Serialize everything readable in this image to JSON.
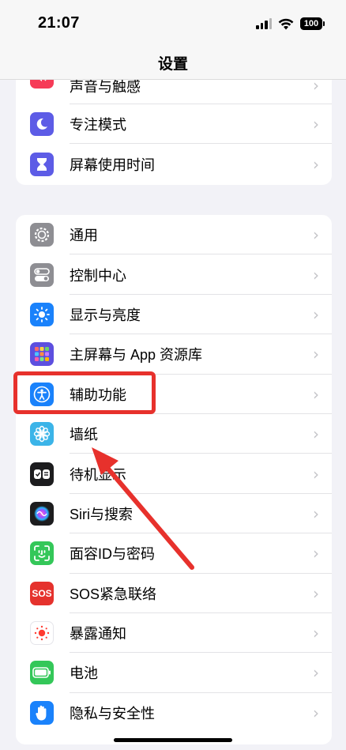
{
  "status_bar": {
    "time": "21:07",
    "battery": "100"
  },
  "nav": {
    "title": "设置"
  },
  "groups": [
    {
      "items": [
        {
          "label": "声音与触感",
          "icon": "speaker-icon",
          "color": "#f63b57"
        },
        {
          "label": "专注模式",
          "icon": "moon-icon",
          "color": "#5d5ce6"
        },
        {
          "label": "屏幕使用时间",
          "icon": "hourglass-icon",
          "color": "#5d5ce6"
        }
      ]
    },
    {
      "items": [
        {
          "label": "通用",
          "icon": "gear-icon",
          "color": "#8e8e93"
        },
        {
          "label": "控制中心",
          "icon": "toggles-icon",
          "color": "#8e8e93"
        },
        {
          "label": "显示与亮度",
          "icon": "sun-icon",
          "color": "#1a82fb"
        },
        {
          "label": "主屏幕与 App 资源库",
          "icon": "app-grid-icon",
          "color": "#5d4fdf"
        },
        {
          "label": "辅助功能",
          "icon": "accessibility-icon",
          "color": "#1a82fb"
        },
        {
          "label": "墙纸",
          "icon": "flower-icon",
          "color": "#3bb4e8"
        },
        {
          "label": "待机显示",
          "icon": "standby-icon",
          "color": "#1c1c1e"
        },
        {
          "label": "Siri与搜索",
          "icon": "siri-icon",
          "color": "#1c1c1e"
        },
        {
          "label": "面容ID与密码",
          "icon": "face-id-icon",
          "color": "#34c759"
        },
        {
          "label": "SOS紧急联络",
          "icon": "sos-icon",
          "color": "#e5322d"
        },
        {
          "label": "暴露通知",
          "icon": "exposure-icon",
          "color": "#ffffff"
        },
        {
          "label": "电池",
          "icon": "battery-icon",
          "color": "#34c759"
        },
        {
          "label": "隐私与安全性",
          "icon": "hand-icon",
          "color": "#1a82fb"
        }
      ]
    }
  ],
  "sos_text": "SOS",
  "annotation": {
    "highlight_color": "#e7312c"
  }
}
